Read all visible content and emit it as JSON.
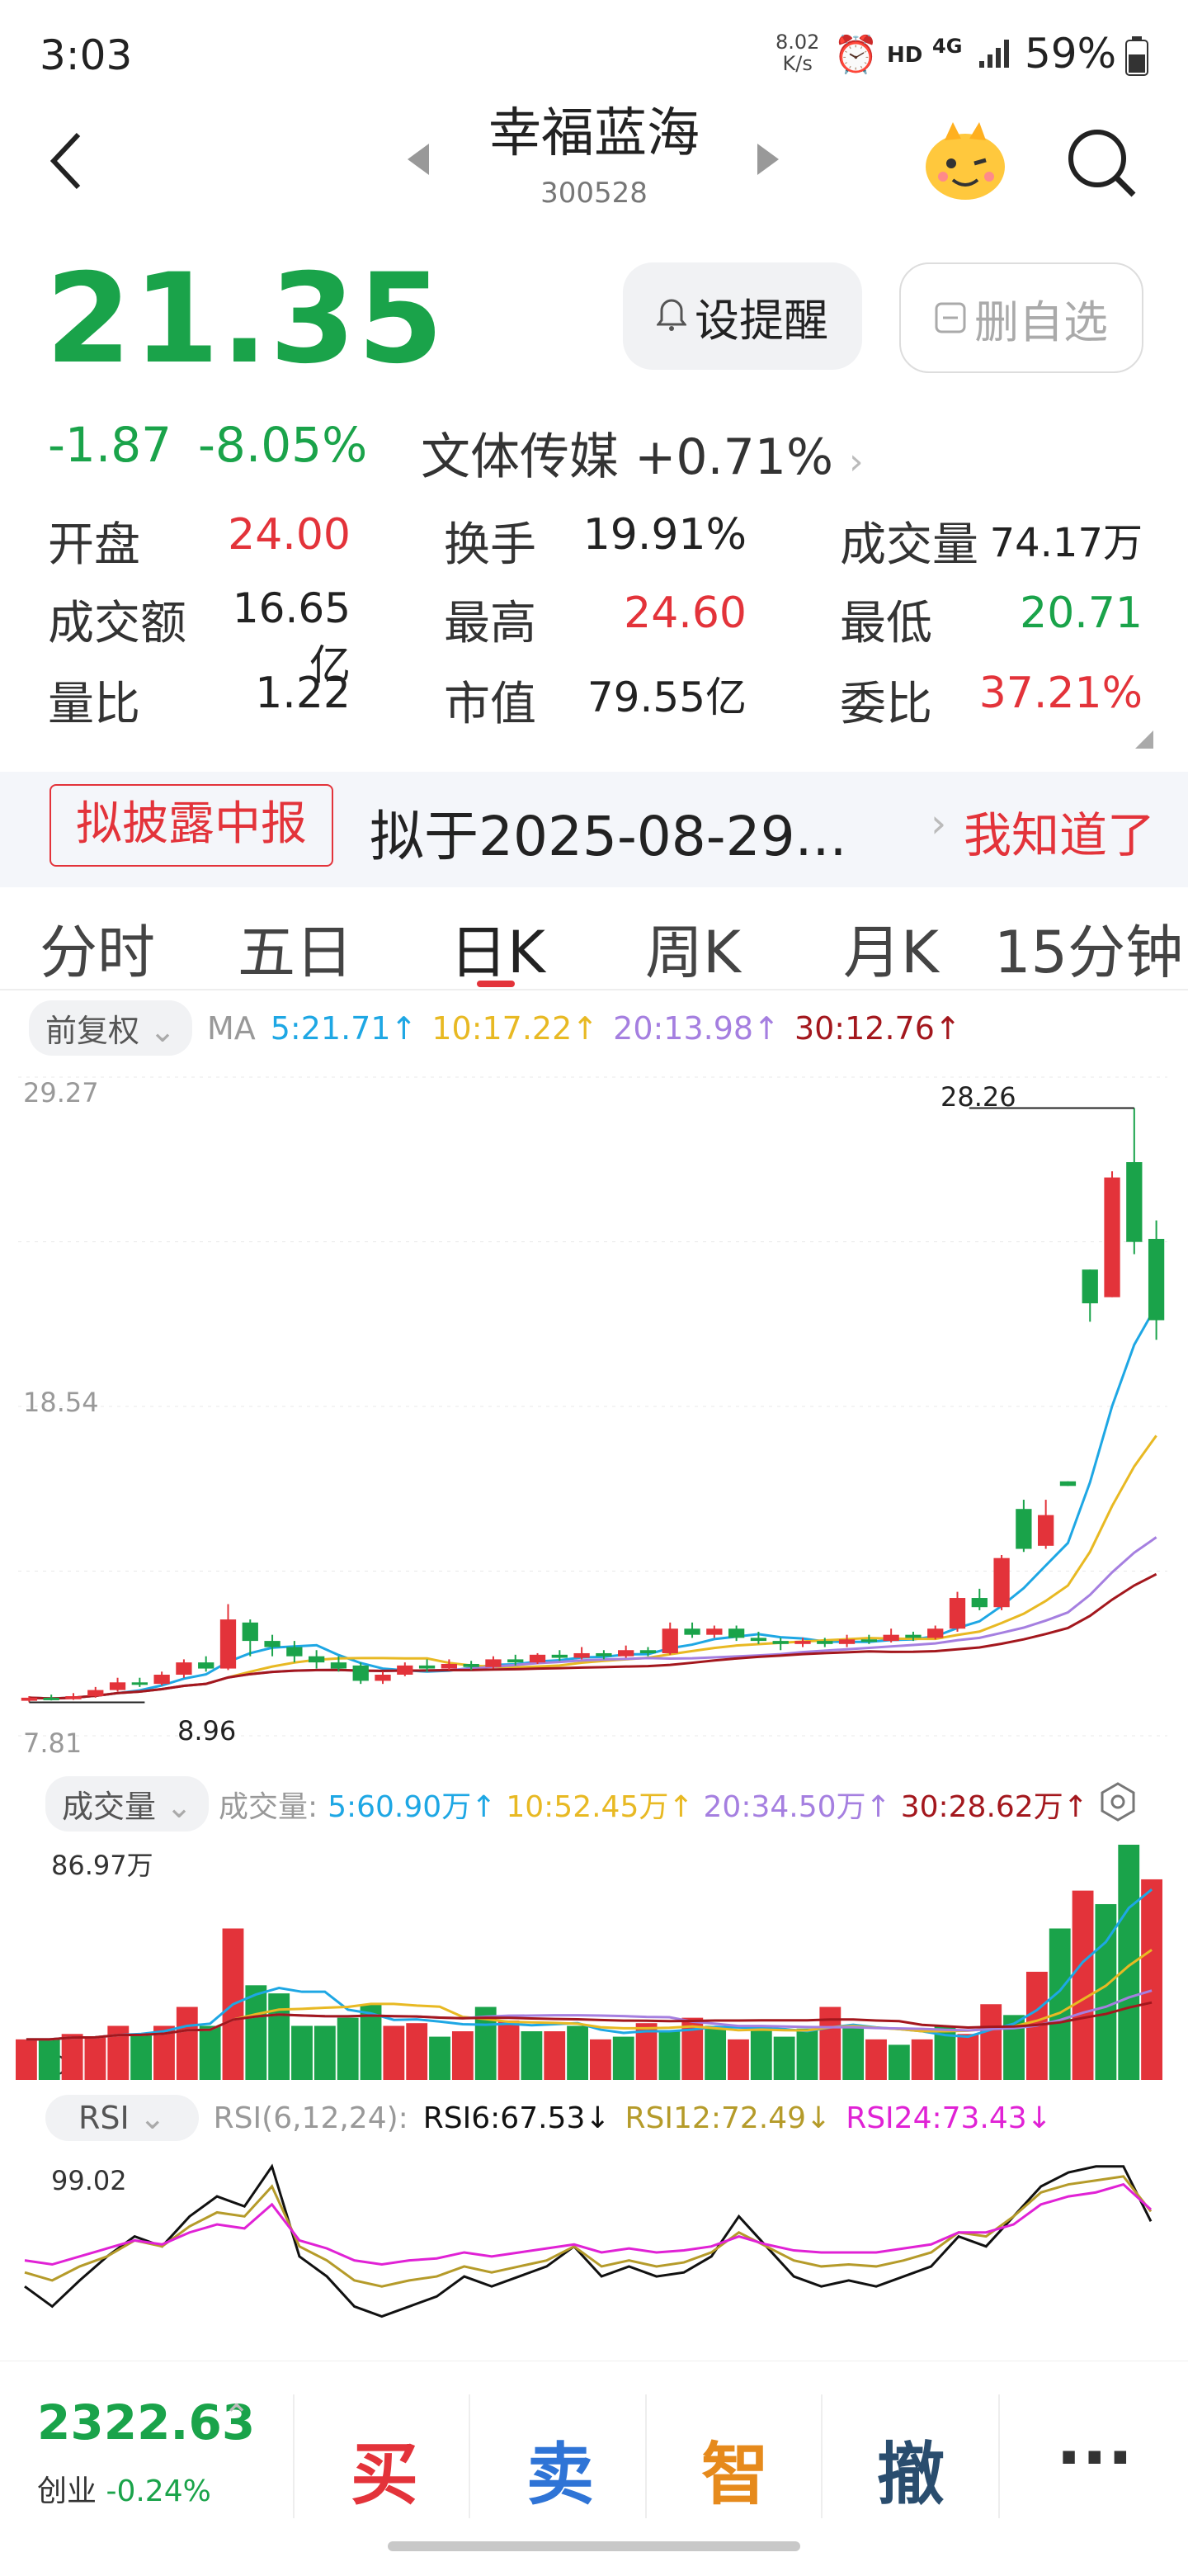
{
  "status": {
    "time": "3:03",
    "net_speed": "8.02",
    "net_unit": "K/s",
    "hd": "HD",
    "signal": "4G",
    "battery": "59%"
  },
  "header": {
    "name": "幸福蓝海",
    "code": "300528"
  },
  "quote": {
    "price": "21.35",
    "change": "-1.87",
    "change_pct": "-8.05%",
    "sector": "文体传媒",
    "sector_pct": "+0.71%",
    "remind_label": "设提醒",
    "delete_label": "删自选"
  },
  "stats": {
    "open_label": "开盘",
    "open": "24.00",
    "turnover_label": "换手",
    "turnover": "19.91%",
    "volume_label": "成交量",
    "volume": "74.17万",
    "amount_label": "成交额",
    "amount": "16.65亿",
    "high_label": "最高",
    "high": "24.60",
    "low_label": "最低",
    "low": "20.71",
    "ratio_label": "量比",
    "ratio": "1.22",
    "mcap_label": "市值",
    "mcap": "79.55亿",
    "wb_label": "委比",
    "wb": "37.21%"
  },
  "banner": {
    "tag": "拟披露中报",
    "text": "拟于2025-08-29...",
    "action": "我知道了"
  },
  "tabs": [
    "分时",
    "五日",
    "日K",
    "周K",
    "月K",
    "15分钟"
  ],
  "kline": {
    "adjust_label": "前复权",
    "ma_prefix": "MA",
    "ma5": "5:21.71↑",
    "ma10": "10:17.22↑",
    "ma20": "20:13.98↑",
    "ma30": "30:12.76↑",
    "y_top": "29.27",
    "y_mid": "18.54",
    "y_bot": "7.81",
    "max_label": "28.26",
    "min_label": "8.96"
  },
  "volume": {
    "label": "成交量",
    "prefix": "成交量:",
    "ma5": "5:60.90万↑",
    "ma10": "10:52.45万↑",
    "ma20": "20:34.50万↑",
    "ma30": "30:28.62万↑",
    "y_top": "86.97万",
    "y_bot": "0"
  },
  "rsi": {
    "label": "RSI",
    "params": "RSI(6,12,24):",
    "rsi6": "RSI6:67.53↓",
    "rsi12": "RSI12:72.49↓",
    "rsi24": "RSI24:73.43↓",
    "y_top": "99.02"
  },
  "bottom": {
    "index_value": "2322.63",
    "index_name": "创业",
    "index_pct": "-0.24%",
    "buy": "买",
    "sell": "卖",
    "smart": "智",
    "cancel": "撤",
    "more": "···"
  },
  "colors": {
    "up": "#e3333a",
    "down": "#1aa34a",
    "ma5": "#1ea7e4",
    "ma10": "#e8b923",
    "ma20": "#a57fe0",
    "ma30": "#a3171d",
    "rsi6": "#111111",
    "rsi12": "#b59b2a",
    "rsi24": "#e022d5"
  },
  "chart_data": [
    {
      "type": "candlestick",
      "title": "",
      "ylim": [
        7.81,
        29.27
      ],
      "candles": [
        {
          "o": 8.95,
          "c": 9.05,
          "h": 9.1,
          "l": 8.9
        },
        {
          "o": 9.05,
          "c": 9.0,
          "h": 9.15,
          "l": 8.96
        },
        {
          "o": 9.0,
          "c": 9.1,
          "h": 9.2,
          "l": 8.98
        },
        {
          "o": 9.1,
          "c": 9.3,
          "h": 9.4,
          "l": 9.05
        },
        {
          "o": 9.3,
          "c": 9.55,
          "h": 9.7,
          "l": 9.25
        },
        {
          "o": 9.55,
          "c": 9.5,
          "h": 9.7,
          "l": 9.4
        },
        {
          "o": 9.5,
          "c": 9.8,
          "h": 9.9,
          "l": 9.45
        },
        {
          "o": 9.8,
          "c": 10.2,
          "h": 10.3,
          "l": 9.7
        },
        {
          "o": 10.2,
          "c": 10.0,
          "h": 10.4,
          "l": 9.9
        },
        {
          "o": 10.0,
          "c": 11.6,
          "h": 12.1,
          "l": 9.95
        },
        {
          "o": 11.5,
          "c": 10.9,
          "h": 11.6,
          "l": 10.4
        },
        {
          "o": 10.9,
          "c": 10.7,
          "h": 11.1,
          "l": 10.4
        },
        {
          "o": 10.7,
          "c": 10.4,
          "h": 10.9,
          "l": 10.2
        },
        {
          "o": 10.4,
          "c": 10.2,
          "h": 10.6,
          "l": 10.0
        },
        {
          "o": 10.2,
          "c": 10.0,
          "h": 10.4,
          "l": 9.9
        },
        {
          "o": 10.1,
          "c": 9.6,
          "h": 10.2,
          "l": 9.5
        },
        {
          "o": 9.6,
          "c": 9.8,
          "h": 9.9,
          "l": 9.5
        },
        {
          "o": 9.8,
          "c": 10.1,
          "h": 10.2,
          "l": 9.75
        },
        {
          "o": 10.1,
          "c": 10.0,
          "h": 10.3,
          "l": 9.9
        },
        {
          "o": 10.0,
          "c": 10.15,
          "h": 10.3,
          "l": 9.95
        },
        {
          "o": 10.15,
          "c": 10.05,
          "h": 10.25,
          "l": 9.95
        },
        {
          "o": 10.05,
          "c": 10.3,
          "h": 10.4,
          "l": 10.0
        },
        {
          "o": 10.3,
          "c": 10.2,
          "h": 10.45,
          "l": 10.1
        },
        {
          "o": 10.2,
          "c": 10.45,
          "h": 10.5,
          "l": 10.15
        },
        {
          "o": 10.45,
          "c": 10.35,
          "h": 10.6,
          "l": 10.25
        },
        {
          "o": 10.35,
          "c": 10.5,
          "h": 10.7,
          "l": 10.3
        },
        {
          "o": 10.5,
          "c": 10.4,
          "h": 10.6,
          "l": 10.3
        },
        {
          "o": 10.4,
          "c": 10.6,
          "h": 10.75,
          "l": 10.35
        },
        {
          "o": 10.6,
          "c": 10.5,
          "h": 10.7,
          "l": 10.4
        },
        {
          "o": 10.5,
          "c": 11.3,
          "h": 11.5,
          "l": 10.45
        },
        {
          "o": 11.3,
          "c": 11.1,
          "h": 11.5,
          "l": 11.0
        },
        {
          "o": 11.1,
          "c": 11.3,
          "h": 11.4,
          "l": 11.0
        },
        {
          "o": 11.3,
          "c": 11.0,
          "h": 11.4,
          "l": 10.9
        },
        {
          "o": 11.0,
          "c": 10.9,
          "h": 11.2,
          "l": 10.8
        },
        {
          "o": 10.9,
          "c": 10.8,
          "h": 11.0,
          "l": 10.6
        },
        {
          "o": 10.8,
          "c": 10.9,
          "h": 11.0,
          "l": 10.7
        },
        {
          "o": 10.9,
          "c": 10.8,
          "h": 11.0,
          "l": 10.7
        },
        {
          "o": 10.8,
          "c": 10.95,
          "h": 11.1,
          "l": 10.7
        },
        {
          "o": 10.95,
          "c": 10.9,
          "h": 11.1,
          "l": 10.8
        },
        {
          "o": 10.9,
          "c": 11.1,
          "h": 11.3,
          "l": 10.85
        },
        {
          "o": 11.1,
          "c": 11.0,
          "h": 11.2,
          "l": 10.9
        },
        {
          "o": 11.0,
          "c": 11.3,
          "h": 11.4,
          "l": 10.95
        },
        {
          "o": 11.3,
          "c": 12.3,
          "h": 12.5,
          "l": 11.2
        },
        {
          "o": 12.3,
          "c": 12.0,
          "h": 12.6,
          "l": 11.9
        },
        {
          "o": 12.0,
          "c": 13.6,
          "h": 13.7,
          "l": 11.9
        },
        {
          "o": 15.2,
          "c": 13.9,
          "h": 15.5,
          "l": 13.8
        },
        {
          "o": 14.0,
          "c": 15.0,
          "h": 15.5,
          "l": 13.9
        },
        {
          "o": 16.1,
          "c": 15.95,
          "h": 16.1,
          "l": 15.95
        },
        {
          "o": 23.0,
          "c": 21.9,
          "h": 23.0,
          "l": 21.3
        },
        {
          "o": 22.1,
          "c": 26.0,
          "h": 26.2,
          "l": 22.1
        },
        {
          "o": 26.5,
          "c": 23.9,
          "h": 28.26,
          "l": 23.5
        },
        {
          "o": 24.0,
          "c": 21.35,
          "h": 24.6,
          "l": 20.71
        }
      ],
      "ma_last": {
        "ma5": 21.71,
        "ma10": 17.22,
        "ma20": 13.98,
        "ma30": 12.76
      }
    },
    {
      "type": "bar",
      "title": "成交量",
      "unit": "万",
      "ylim": [
        0,
        86.97
      ],
      "values": [
        15,
        15,
        17,
        16,
        20,
        17,
        20,
        27,
        20,
        56,
        35,
        32,
        20,
        20,
        23,
        28,
        20,
        21,
        16,
        18,
        27,
        22,
        18,
        18,
        20,
        15,
        16,
        21,
        18,
        23,
        20,
        15,
        20,
        16,
        19,
        27,
        20,
        15,
        13,
        15,
        20,
        17,
        28,
        24,
        40,
        56,
        70,
        65,
        86.97,
        74.17
      ],
      "ma_last": {
        "ma5": 60.9,
        "ma10": 52.45,
        "ma20": 34.5,
        "ma30": 28.62
      }
    },
    {
      "type": "line",
      "title": "RSI(6,12,24)",
      "ylim": [
        0,
        99.02
      ],
      "series": [
        {
          "name": "RSI6",
          "last": 67.53,
          "values": [
            35,
            25,
            38,
            50,
            60,
            55,
            70,
            80,
            75,
            95,
            50,
            40,
            25,
            20,
            25,
            30,
            40,
            35,
            40,
            45,
            55,
            40,
            45,
            40,
            42,
            50,
            70,
            55,
            40,
            35,
            38,
            35,
            40,
            45,
            60,
            55,
            70,
            85,
            92,
            95,
            95,
            67.53
          ]
        },
        {
          "name": "RSI12",
          "last": 72.49,
          "values": [
            42,
            38,
            45,
            50,
            58,
            55,
            65,
            72,
            70,
            85,
            55,
            48,
            38,
            35,
            38,
            40,
            45,
            42,
            45,
            48,
            55,
            45,
            48,
            45,
            47,
            52,
            62,
            55,
            48,
            45,
            46,
            45,
            48,
            52,
            62,
            60,
            70,
            82,
            86,
            88,
            90,
            72.49
          ]
        },
        {
          "name": "RSI24",
          "last": 73.43,
          "values": [
            48,
            46,
            50,
            54,
            58,
            56,
            62,
            66,
            64,
            76,
            58,
            54,
            48,
            46,
            48,
            49,
            52,
            50,
            52,
            54,
            56,
            52,
            54,
            52,
            53,
            55,
            60,
            56,
            53,
            52,
            52,
            52,
            54,
            56,
            62,
            62,
            66,
            76,
            80,
            82,
            86,
            73.43
          ]
        }
      ]
    }
  ]
}
